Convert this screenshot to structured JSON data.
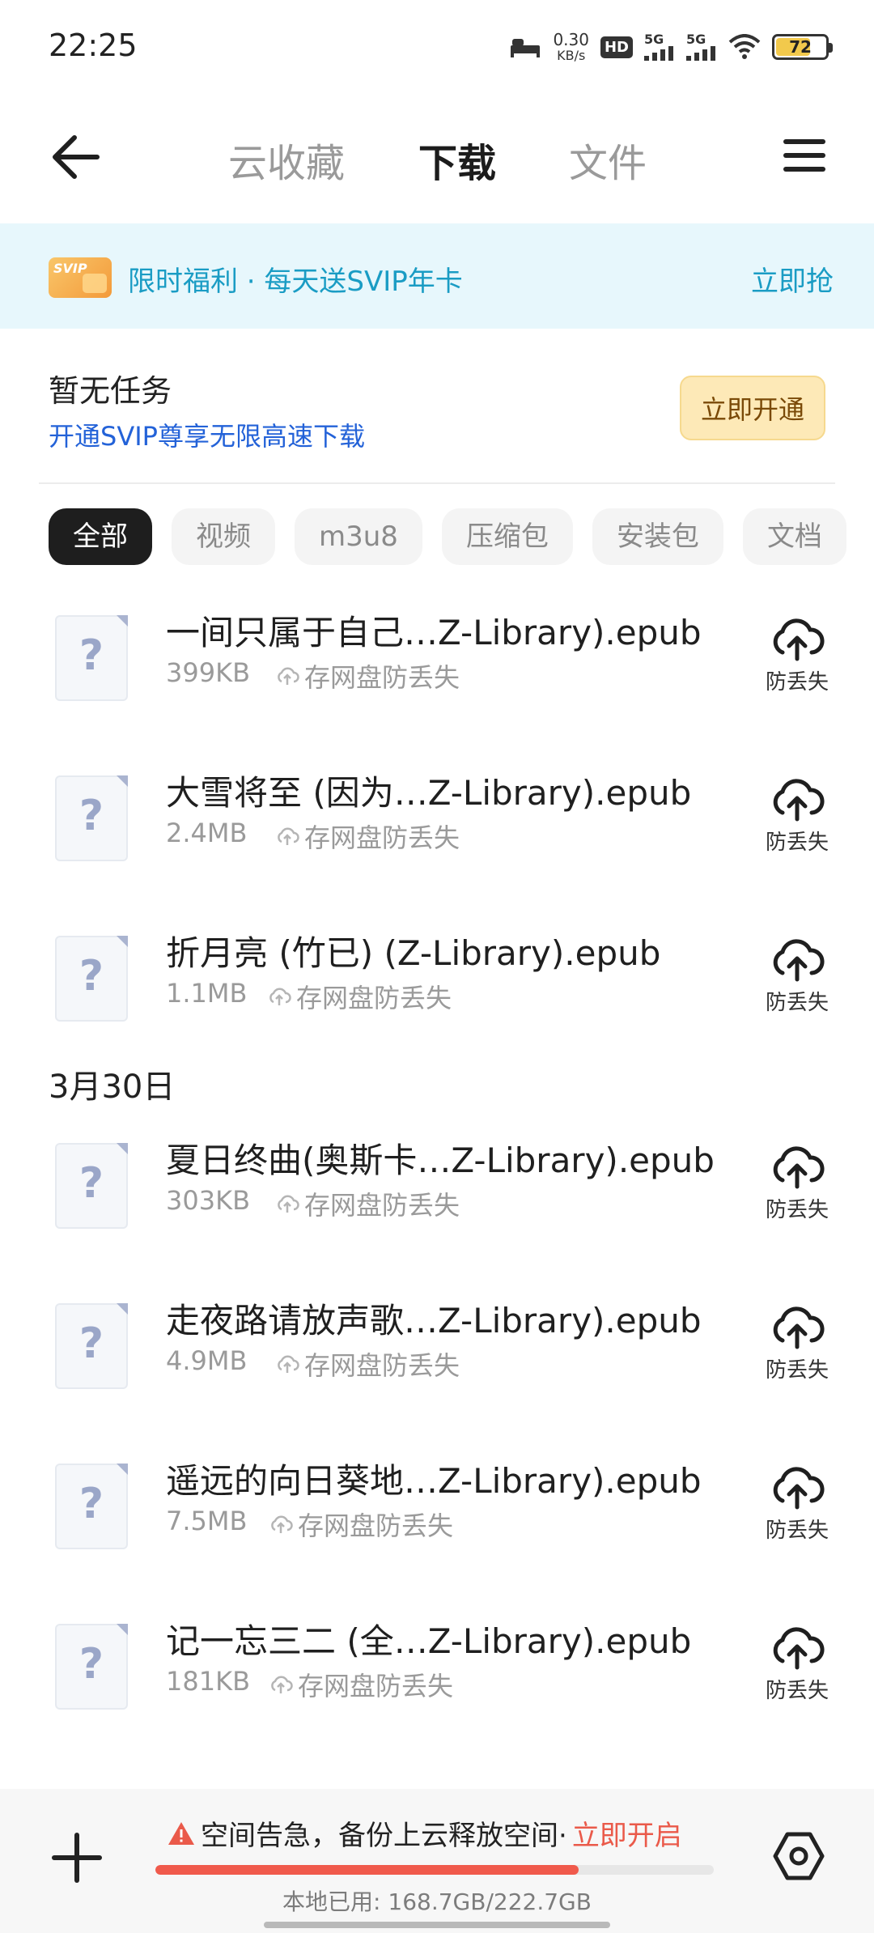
{
  "status_bar": {
    "time": "22:25",
    "net_speed": "0.30",
    "net_unit": "KB/s",
    "hd_label": "HD",
    "sim1_gen": "5G",
    "sim2_gen": "5G",
    "battery": "72"
  },
  "header": {
    "tabs": [
      {
        "label": "云收藏"
      },
      {
        "label": "下载"
      },
      {
        "label": "文件"
      }
    ]
  },
  "promo": {
    "badge": "SVIP",
    "text": "限时福利 · 每天送SVIP年卡",
    "action": "立即抢"
  },
  "task": {
    "title": "暂无任务",
    "subtitle": "开通SVIP尊享无限高速下载",
    "button": "立即开通"
  },
  "filters": [
    {
      "label": "全部"
    },
    {
      "label": "视频"
    },
    {
      "label": "m3u8"
    },
    {
      "label": "压缩包"
    },
    {
      "label": "安装包"
    },
    {
      "label": "文档"
    }
  ],
  "files_recent": [
    {
      "name": "一间只属于自己…Z-Library).epub",
      "size": "399KB",
      "backup": "存网盘防丢失",
      "action": "防丢失"
    },
    {
      "name": "大雪将至 (因为…Z-Library).epub",
      "size": "2.4MB",
      "backup": "存网盘防丢失",
      "action": "防丢失"
    },
    {
      "name": "折月亮 (竹已) (Z-Library).epub",
      "size": "1.1MB",
      "backup": "存网盘防丢失",
      "action": "防丢失"
    }
  ],
  "date_group": "3月30日",
  "files_march30": [
    {
      "name": "夏日终曲(奥斯卡…Z-Library).epub",
      "size": "303KB",
      "backup": "存网盘防丢失",
      "action": "防丢失"
    },
    {
      "name": "走夜路请放声歌…Z-Library).epub",
      "size": "4.9MB",
      "backup": "存网盘防丢失",
      "action": "防丢失"
    },
    {
      "name": "遥远的向日葵地…Z-Library).epub",
      "size": "7.5MB",
      "backup": "存网盘防丢失",
      "action": "防丢失"
    },
    {
      "name": "记一忘三二 (全…Z-Library).epub",
      "size": "181KB",
      "backup": "存网盘防丢失",
      "action": "防丢失"
    }
  ],
  "bottom_bar": {
    "warning": "空间告急，备份上云释放空间·",
    "warning_action": "立即开启",
    "storage_text": "本地已用: 168.7GB/222.7GB",
    "storage_used_fraction": 0.7575
  },
  "colors": {
    "accent_blue": "#1a9cc4",
    "link_blue": "#2362d8",
    "warning_red": "#ea5a4a"
  }
}
